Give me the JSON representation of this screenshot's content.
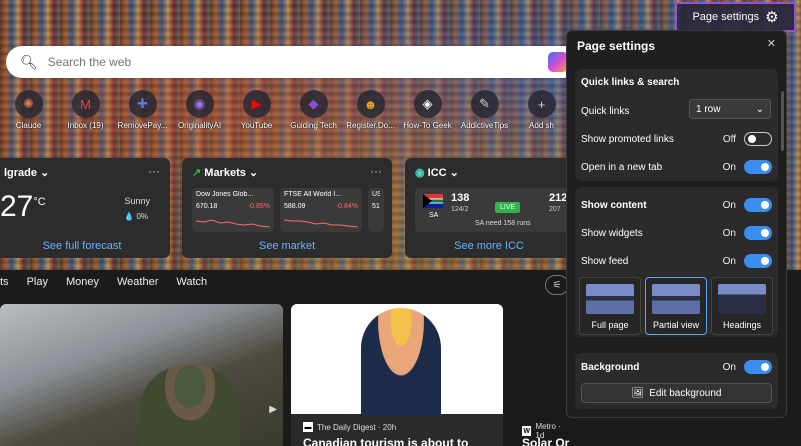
{
  "page_settings_button": {
    "label": "Page settings",
    "icon": "gear-icon"
  },
  "search": {
    "placeholder": "Search the web",
    "icon": "search-icon"
  },
  "quick_links": [
    {
      "label": "Claude",
      "icon": "✺",
      "color": "#d97757"
    },
    {
      "label": "Inbox (19)",
      "icon": "M",
      "color": "#ea4335"
    },
    {
      "label": "RemovePay...",
      "icon": "✚",
      "color": "#5a7bd8"
    },
    {
      "label": "OriginalityAI",
      "icon": "◉",
      "color": "#a070f0"
    },
    {
      "label": "YouTube",
      "icon": "▶",
      "color": "#ff0000"
    },
    {
      "label": "Guiding Tech",
      "icon": "◆",
      "color": "#8a4fd8"
    },
    {
      "label": "Register.Do...",
      "icon": "☻",
      "color": "#f0a020"
    },
    {
      "label": "How-To Geek",
      "icon": "◈",
      "color": "#ffffff"
    },
    {
      "label": "AddictiveTips",
      "icon": "✎",
      "color": "#cccccc"
    },
    {
      "label": "Add sh",
      "icon": "+",
      "color": "#cccccc"
    }
  ],
  "weather": {
    "location": "lgrade",
    "temp": "27",
    "unit": "°C",
    "condition": "Sunny",
    "precip": "0%",
    "link": "See full forecast"
  },
  "markets": {
    "title": "Markets",
    "stocks": [
      {
        "name": "Dow Jones Glob...",
        "value": "670.18",
        "change": "-0.85%"
      },
      {
        "name": "FTSE All World I...",
        "value": "588.09",
        "change": "-0.84%"
      },
      {
        "name": "US",
        "value": "51",
        "change": ""
      }
    ],
    "link": "See market"
  },
  "icc": {
    "title": "ICC",
    "team": "SA",
    "score": "138",
    "overs": "124/2",
    "status": "LIVE",
    "need": "SA need 158 runs",
    "right_score": "212",
    "right_sub": "207",
    "link": "See more ICC"
  },
  "feed_nav": [
    "ts",
    "Play",
    "Money",
    "Weather",
    "Watch"
  ],
  "news": [
    {
      "source": "",
      "title": ""
    },
    {
      "source": "The Daily Digest · 20h",
      "title": "Canadian tourism is about to"
    },
    {
      "source": "Metro · 1d",
      "title": "Solar Orbiter spacecraft"
    }
  ],
  "panel": {
    "title": "Page settings",
    "quick": {
      "header": "Quick links & search",
      "quick_links_label": "Quick links",
      "quick_links_value": "1 row",
      "promoted_label": "Show promoted links",
      "promoted_state": "Off",
      "newtab_label": "Open in a new tab",
      "newtab_state": "On"
    },
    "content": {
      "show_content_label": "Show content",
      "show_content_state": "On",
      "widgets_label": "Show widgets",
      "widgets_state": "On",
      "feed_label": "Show feed",
      "feed_state": "On",
      "layouts": [
        "Full page",
        "Partial view",
        "Headings"
      ]
    },
    "background": {
      "label": "Background",
      "state": "On",
      "edit_label": "Edit background"
    }
  }
}
